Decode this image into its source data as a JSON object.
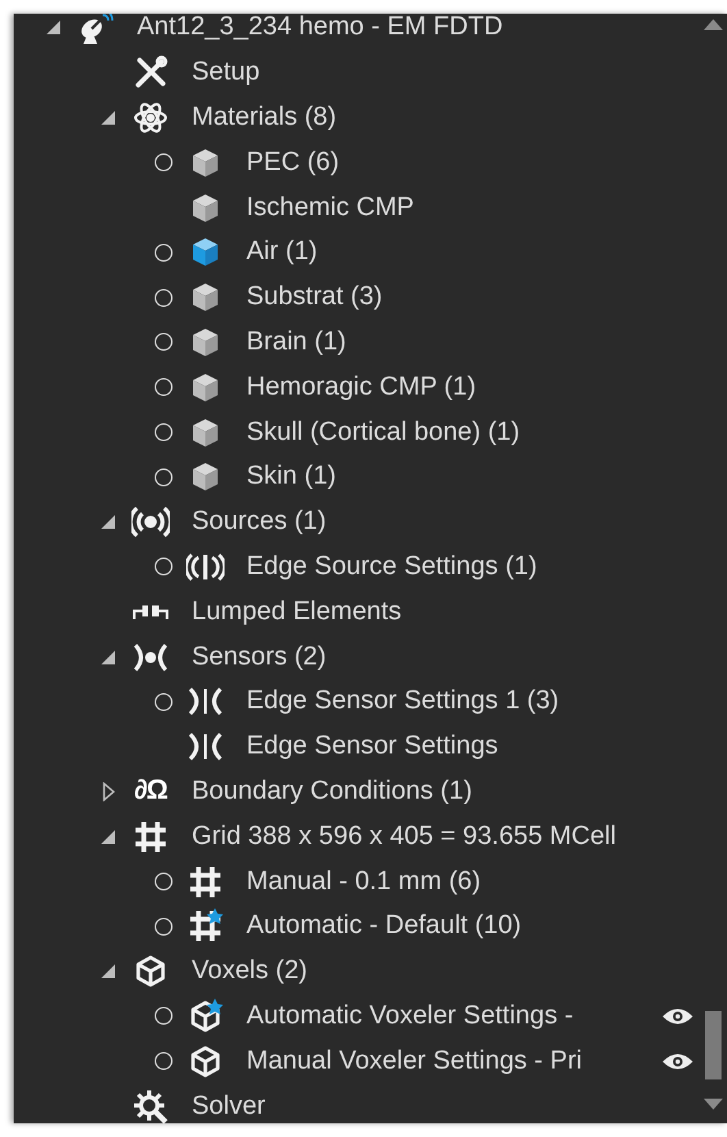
{
  "tree": [
    {
      "label": "Ant12_3_234 hemo - EM FDTD",
      "kind": "antenna",
      "expanded": true,
      "children": [
        {
          "label": "Setup",
          "kind": "tools"
        },
        {
          "label": "Materials (8)",
          "kind": "atom",
          "expanded": true,
          "children": [
            {
              "label": "PEC (6)",
              "kind": "ring-cube"
            },
            {
              "label": "Ischemic CMP",
              "kind": "cube"
            },
            {
              "label": "Air (1)",
              "kind": "ring-cube-blue"
            },
            {
              "label": "Substrat (3)",
              "kind": "ring-cube"
            },
            {
              "label": "Brain (1)",
              "kind": "ring-cube"
            },
            {
              "label": "Hemoragic CMP (1)",
              "kind": "ring-cube"
            },
            {
              "label": "Skull (Cortical bone) (1)",
              "kind": "ring-cube"
            },
            {
              "label": "Skin (1)",
              "kind": "ring-cube"
            }
          ]
        },
        {
          "label": "Sources (1)",
          "kind": "sources",
          "expanded": true,
          "children": [
            {
              "label": "Edge Source Settings (1)",
              "kind": "ring-source"
            }
          ]
        },
        {
          "label": "Lumped Elements",
          "kind": "lumped"
        },
        {
          "label": "Sensors (2)",
          "kind": "sensors",
          "expanded": true,
          "children": [
            {
              "label": "Edge Sensor Settings 1 (3)",
              "kind": "ring-sensor"
            },
            {
              "label": "Edge Sensor Settings",
              "kind": "sensor"
            }
          ]
        },
        {
          "label": "Boundary Conditions (1)",
          "kind": "glyph",
          "glyph": "∂Ω",
          "expanded": false
        },
        {
          "label": "Grid 388 x 596 x 405 = 93.655 MCell",
          "kind": "grid",
          "expanded": true,
          "children": [
            {
              "label": "Manual - 0.1 mm (6)",
              "kind": "ring-grid"
            },
            {
              "label": "Automatic - Default (10)",
              "kind": "ring-grid-auto"
            }
          ]
        },
        {
          "label": "Voxels (2)",
          "kind": "voxel",
          "expanded": true,
          "children": [
            {
              "label": "Automatic Voxeler Settings -",
              "kind": "ring-voxel-auto",
              "eye": true
            },
            {
              "label": "Manual Voxeler Settings - Pri",
              "kind": "ring-voxel",
              "eye": true
            }
          ]
        },
        {
          "label": "Solver",
          "kind": "solver"
        }
      ]
    }
  ]
}
